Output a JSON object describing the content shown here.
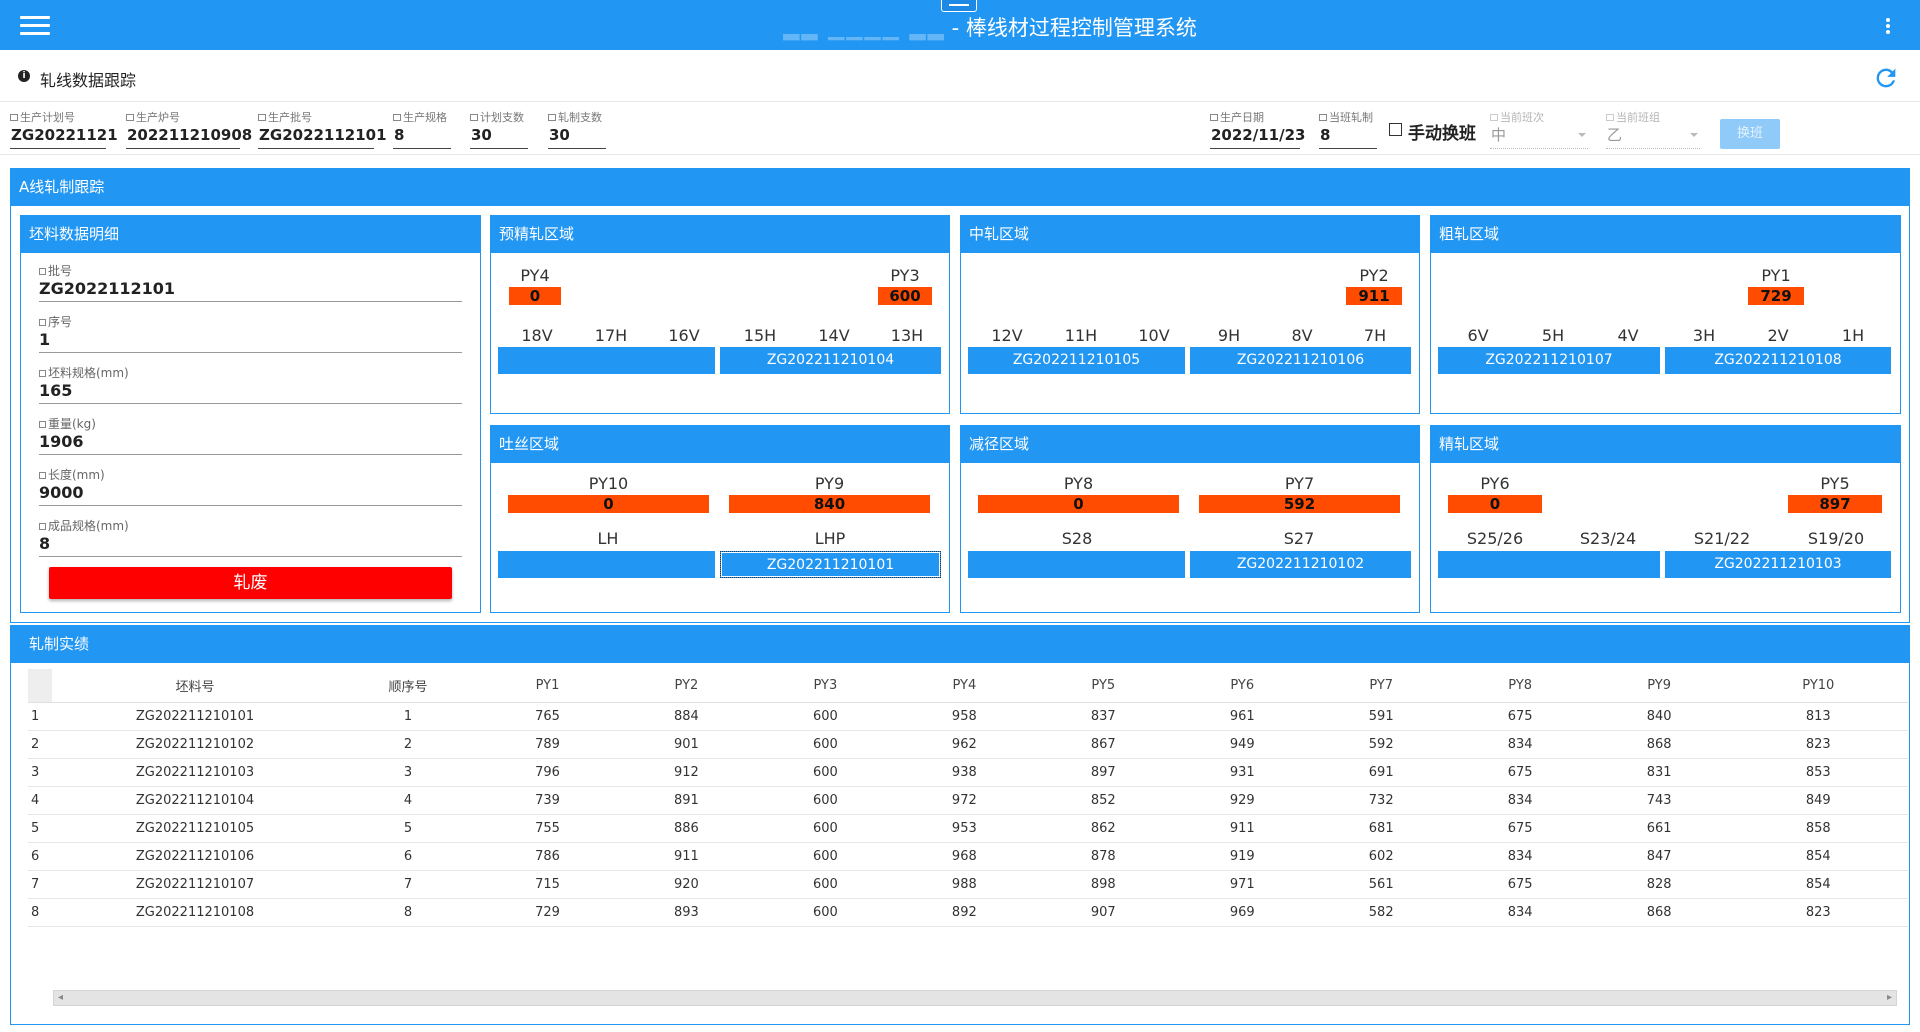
{
  "app": {
    "title": "- 棒线材过程控制管理系统"
  },
  "page": {
    "title": "轧线数据跟踪"
  },
  "form": {
    "plan_no": {
      "label": "生产计划号",
      "value": "ZG20221121"
    },
    "heat_no": {
      "label": "生产炉号",
      "value": "202211210908"
    },
    "batch_no": {
      "label": "生产批号",
      "value": "ZG2022112101"
    },
    "spec": {
      "label": "生产规格",
      "value": "8"
    },
    "plan_count": {
      "label": "计划支数",
      "value": "30"
    },
    "rolled_count": {
      "label": "轧制支数",
      "value": "30"
    },
    "prod_date": {
      "label": "生产日期",
      "value": "2022/11/23"
    },
    "shift_rolled": {
      "label": "当班轧制",
      "value": "8"
    },
    "manual_shift_label": "手动换班",
    "current_shift": {
      "label": "当前班次",
      "value": "中"
    },
    "current_team": {
      "label": "当前班组",
      "value": "乙"
    },
    "shift_button": "换班"
  },
  "tracking": {
    "title": "A线轧制跟踪",
    "billet": {
      "title": "坯料数据明细",
      "fields": [
        {
          "label": "批号",
          "value": "ZG2022112101"
        },
        {
          "label": "序号",
          "value": "1"
        },
        {
          "label": "坯料规格(mm)",
          "value": "165"
        },
        {
          "label": "重量(kg)",
          "value": "1906"
        },
        {
          "label": "长度(mm)",
          "value": "9000"
        },
        {
          "label": "成品规格(mm)",
          "value": "8"
        }
      ],
      "scrap_button": "轧废"
    },
    "zones": {
      "pre_finish": {
        "title": "预精轧区域",
        "py_a": {
          "name": "PY4",
          "value": "0"
        },
        "py_b": {
          "name": "PY3",
          "value": "600"
        },
        "stands": [
          "18V",
          "17H",
          "16V",
          "15H",
          "14V",
          "13H"
        ],
        "slots": [
          "",
          "ZG202211210104"
        ]
      },
      "middle": {
        "title": "中轧区域",
        "py_b": {
          "name": "PY2",
          "value": "911"
        },
        "stands": [
          "12V",
          "11H",
          "10V",
          "9H",
          "8V",
          "7H"
        ],
        "slots": [
          "ZG202211210105",
          "ZG202211210106"
        ]
      },
      "rough": {
        "title": "粗轧区域",
        "py_b": {
          "name": "PY1",
          "value": "729"
        },
        "stands": [
          "6V",
          "5H",
          "4V",
          "3H",
          "2V",
          "1H"
        ],
        "slots": [
          "ZG202211210107",
          "ZG202211210108"
        ]
      },
      "laying": {
        "title": "吐丝区域",
        "py_a": {
          "name": "PY10",
          "value": "0"
        },
        "py_b": {
          "name": "PY9",
          "value": "840"
        },
        "stands": [
          "LH",
          "LHP"
        ],
        "slots": [
          "",
          "ZG202211210101"
        ]
      },
      "reducing": {
        "title": "减径区域",
        "py_a": {
          "name": "PY8",
          "value": "0"
        },
        "py_b": {
          "name": "PY7",
          "value": "592"
        },
        "stands": [
          "S28",
          "S27"
        ],
        "slots": [
          "",
          "ZG202211210102"
        ]
      },
      "finish": {
        "title": "精轧区域",
        "py_a": {
          "name": "PY6",
          "value": "0"
        },
        "py_b": {
          "name": "PY5",
          "value": "897"
        },
        "stands": [
          "S25/26",
          "S23/24",
          "S21/22",
          "S19/20"
        ],
        "slots": [
          "",
          "ZG202211210103"
        ]
      }
    }
  },
  "results": {
    "title": "轧制实绩",
    "columns": [
      "坯料号",
      "顺序号",
      "PY1",
      "PY2",
      "PY3",
      "PY4",
      "PY5",
      "PY6",
      "PY7",
      "PY8",
      "PY9",
      "PY10"
    ],
    "rows": [
      [
        "1",
        "ZG202211210101",
        "1",
        "765",
        "884",
        "600",
        "958",
        "837",
        "961",
        "591",
        "675",
        "840",
        "813"
      ],
      [
        "2",
        "ZG202211210102",
        "2",
        "789",
        "901",
        "600",
        "962",
        "867",
        "949",
        "592",
        "834",
        "868",
        "823"
      ],
      [
        "3",
        "ZG202211210103",
        "3",
        "796",
        "912",
        "600",
        "938",
        "897",
        "931",
        "691",
        "675",
        "831",
        "853"
      ],
      [
        "4",
        "ZG202211210104",
        "4",
        "739",
        "891",
        "600",
        "972",
        "852",
        "929",
        "732",
        "834",
        "743",
        "849"
      ],
      [
        "5",
        "ZG202211210105",
        "5",
        "755",
        "886",
        "600",
        "953",
        "862",
        "911",
        "681",
        "675",
        "661",
        "858"
      ],
      [
        "6",
        "ZG202211210106",
        "6",
        "786",
        "911",
        "600",
        "968",
        "878",
        "919",
        "602",
        "834",
        "847",
        "854"
      ],
      [
        "7",
        "ZG202211210107",
        "7",
        "715",
        "920",
        "600",
        "988",
        "898",
        "971",
        "561",
        "675",
        "828",
        "854"
      ],
      [
        "8",
        "ZG202211210108",
        "8",
        "729",
        "893",
        "600",
        "892",
        "907",
        "969",
        "582",
        "834",
        "868",
        "823"
      ]
    ]
  }
}
